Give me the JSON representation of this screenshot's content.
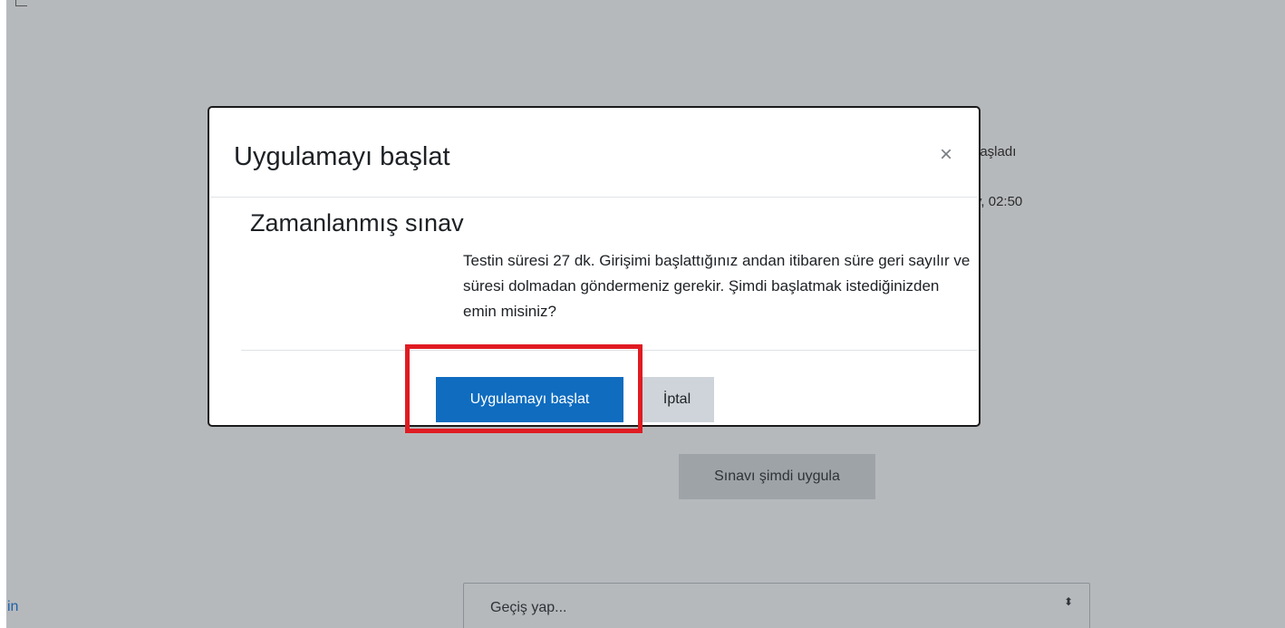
{
  "background": {
    "started_text": "başladı",
    "time_text": "y, 02:50",
    "left_link": "in",
    "attempt_button": "Sınavı şimdi uygula",
    "jump_select": {
      "placeholder": "Geçiş yap...",
      "arrows": "⬍"
    }
  },
  "modal": {
    "title": "Uygulamayı başlat",
    "close_glyph": "×",
    "heading": "Zamanlanmış sınav",
    "body": "Testin süresi 27 dk. Girişimi başlattığınız andan itibaren süre geri sayılır ve süresi dolmadan göndermeniz gerekir. Şimdi başlatmak istediğinizden emin misiniz?",
    "start_button": "Uygulamayı başlat",
    "cancel_button": "İptal"
  },
  "colors": {
    "overlay": "#b6b9bc",
    "primary": "#0f6cbf",
    "secondary": "#ced4da",
    "highlight": "#e01b22"
  }
}
